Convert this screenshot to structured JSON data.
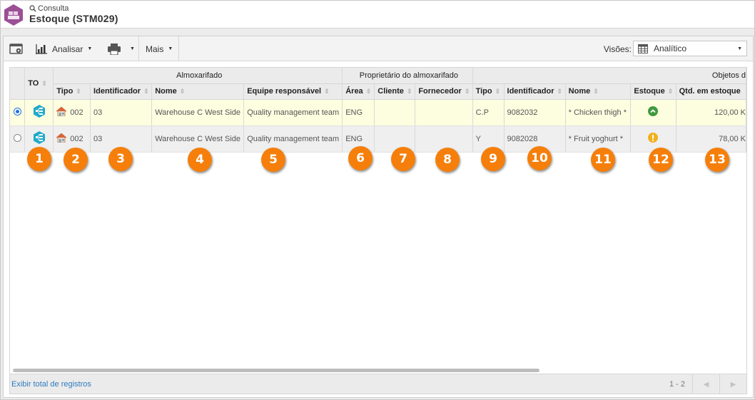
{
  "header": {
    "breadcrumb": "Consulta",
    "title": "Estoque (STM029)",
    "logo_color": "#9b4f96"
  },
  "toolbar": {
    "analyze_label": "Analisar",
    "more_label": "Mais",
    "views_label": "Visões:",
    "views_value": "Analítico"
  },
  "grid": {
    "group_headers": {
      "warehouse": "Almoxarifado",
      "owner": "Proprietário do almoxarifado",
      "objects": "Objetos d"
    },
    "columns": {
      "to": "TO",
      "wh_type": "Tipo",
      "wh_id": "Identificador",
      "wh_name": "Nome",
      "wh_team": "Equipe responsável",
      "area": "Área",
      "client": "Cliente",
      "supplier": "Fornecedor",
      "obj_type": "Tipo",
      "obj_id": "Identificador",
      "obj_name": "Nome",
      "stock": "Estoque",
      "qty": "Qtd. em estoque"
    },
    "rows": [
      {
        "selected": true,
        "wh_type": "002",
        "wh_id": "03",
        "wh_name": "Warehouse C West Side",
        "wh_team": "Quality management team",
        "area": "ENG",
        "client": "",
        "supplier": "",
        "obj_type": "C.P",
        "obj_id": "9082032",
        "obj_name": "* Chicken thigh *",
        "stock_status": "ok",
        "qty": "120,00 K"
      },
      {
        "selected": false,
        "wh_type": "002",
        "wh_id": "03",
        "wh_name": "Warehouse C West Side",
        "wh_team": "Quality management team",
        "area": "ENG",
        "client": "",
        "supplier": "",
        "obj_type": "Y",
        "obj_id": "9082028",
        "obj_name": "* Fruit yoghurt *",
        "stock_status": "warning",
        "qty": "78,00 K"
      }
    ]
  },
  "callouts": [
    "1",
    "2",
    "3",
    "4",
    "5",
    "6",
    "7",
    "8",
    "9",
    "10",
    "11",
    "12",
    "13"
  ],
  "footer": {
    "show_total_label": "Exibir total de registros",
    "range": "1 - 2"
  },
  "colors": {
    "callout": "#f57f0a",
    "selected_row": "#fdfde0",
    "stock_ok": "#3f9a3f",
    "stock_warning": "#f2b01e",
    "link": "#2f7bbf"
  }
}
